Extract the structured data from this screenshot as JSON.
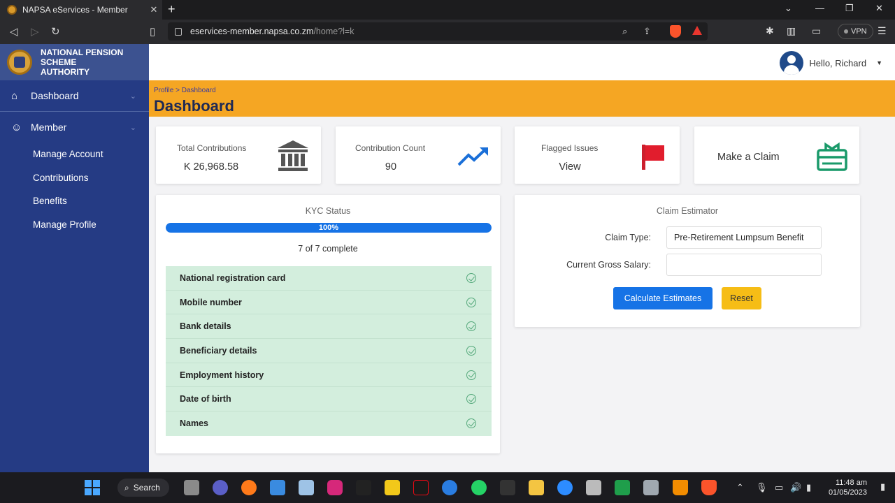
{
  "browser": {
    "tab_title": "NAPSA eServices - Member",
    "url_host": "eservices-member.napsa.co.zm",
    "url_path": "/home?l=k",
    "vpn_label": "VPN"
  },
  "sidebar": {
    "brand": "NATIONAL PENSION SCHEME AUTHORITY",
    "items": [
      {
        "label": "Dashboard",
        "icon": "home-icon"
      },
      {
        "label": "Member",
        "icon": "user-icon"
      }
    ],
    "sub_items": [
      {
        "label": "Manage Account"
      },
      {
        "label": "Contributions"
      },
      {
        "label": "Benefits"
      },
      {
        "label": "Manage Profile"
      }
    ]
  },
  "header": {
    "greeting": "Hello, Richard"
  },
  "banner": {
    "breadcrumb": "Profile > Dashboard",
    "title": "Dashboard"
  },
  "stats": [
    {
      "label": "Total Contributions",
      "value": "K 26,968.58",
      "icon": "bank-icon"
    },
    {
      "label": "Contribution Count",
      "value": "90",
      "icon": "trending-up-icon"
    },
    {
      "label": "Flagged Issues",
      "value": "View",
      "icon": "flag-icon"
    },
    {
      "label": "Make a Claim",
      "icon": "gift-icon"
    }
  ],
  "kyc": {
    "title": "KYC Status",
    "progress_label": "100%",
    "progress_value": 1.0,
    "count": "7 of 7 complete",
    "items": [
      "National registration card",
      "Mobile number",
      "Bank details",
      "Beneficiary details",
      "Employment history",
      "Date of birth",
      "Names"
    ]
  },
  "estimator": {
    "title": "Claim Estimator",
    "claim_type_label": "Claim Type:",
    "claim_type_value": "Pre-Retirement Lumpsum Benefit",
    "salary_label": "Current Gross Salary:",
    "salary_value": "",
    "calculate_label": "Calculate Estimates",
    "reset_label": "Reset"
  },
  "taskbar": {
    "search_label": "Search",
    "time": "11:48 am",
    "date": "01/05/2023"
  },
  "colors": {
    "sidebar": "#253b84",
    "banner": "#f5a623",
    "primary": "#1673e6",
    "warning": "#f6bd16",
    "kyc_row": "#d3eedd"
  }
}
